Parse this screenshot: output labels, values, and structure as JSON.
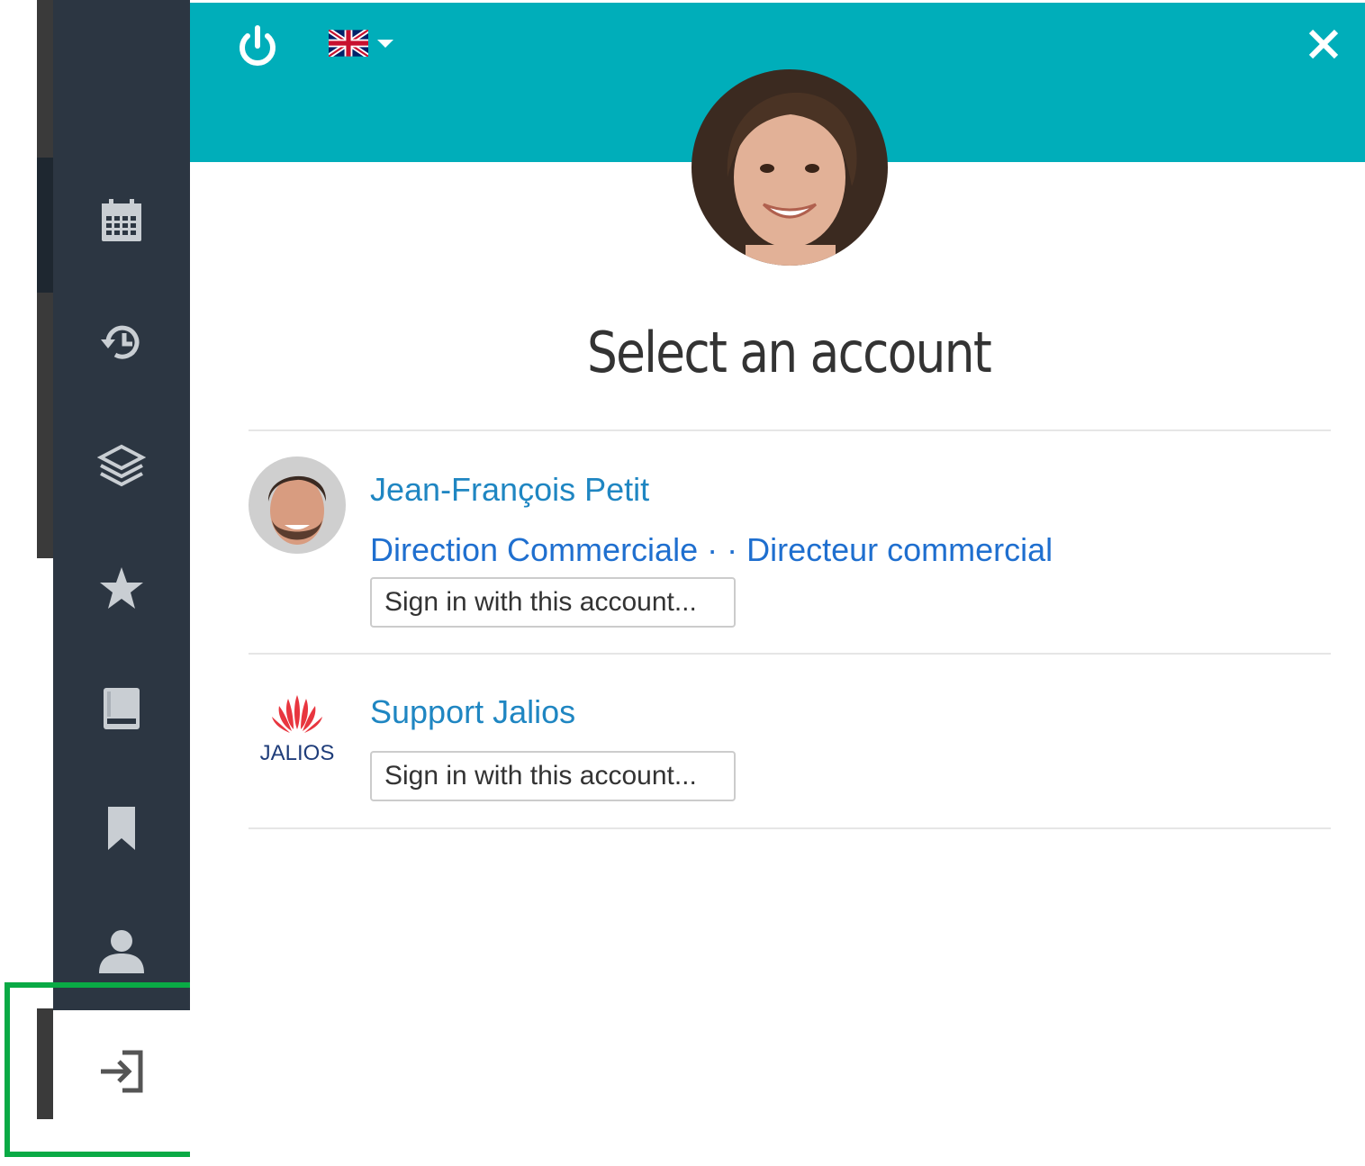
{
  "sidebar": {
    "items": [
      {
        "icon": "calendar-icon"
      },
      {
        "icon": "history-icon"
      },
      {
        "icon": "layers-icon"
      },
      {
        "icon": "star-icon"
      },
      {
        "icon": "book-icon"
      },
      {
        "icon": "bookmark-icon"
      },
      {
        "icon": "user-icon"
      },
      {
        "icon": "sign-in-icon"
      }
    ]
  },
  "header": {
    "power_icon": "power-icon",
    "language_flag": "uk-flag-icon",
    "close_icon": "close-icon"
  },
  "main": {
    "title": "Select an account",
    "accounts": [
      {
        "name": "Jean-François Petit",
        "subtitle": "Direction Commerciale · · Directeur commercial",
        "button": "Sign in with this account..."
      },
      {
        "name": "Support Jalios",
        "logo_text": "JALIOS",
        "button": "Sign in with this account..."
      }
    ]
  },
  "colors": {
    "header": "#00aeba",
    "sidebar": "#2c3642",
    "link": "#1f86c2",
    "highlight": "#0aaa45"
  }
}
